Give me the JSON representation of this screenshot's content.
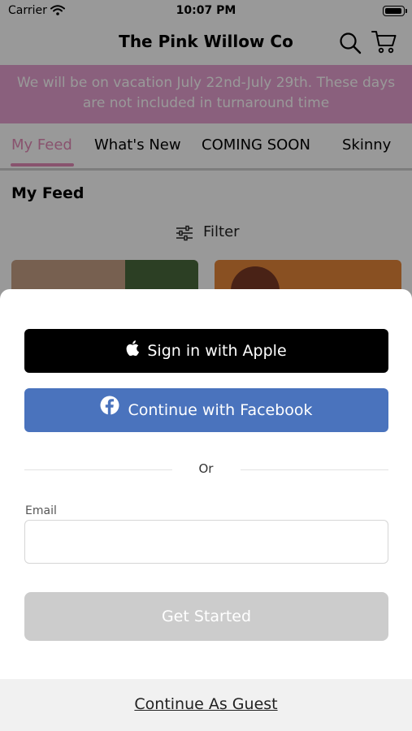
{
  "status_bar": {
    "carrier": "Carrier",
    "time": "10:07 PM"
  },
  "nav": {
    "title": "The Pink Willow Co",
    "search_icon": "search-icon",
    "cart_icon": "cart-icon"
  },
  "banner": {
    "text": "We will be on vacation July 22nd-July 29th. These days are not included in turnaround time",
    "color": "#e6a1d0"
  },
  "tabs": [
    {
      "label": "My Feed",
      "active": true
    },
    {
      "label": "What's New",
      "active": false
    },
    {
      "label": "COMING SOON",
      "active": false
    },
    {
      "label": "Skinny",
      "active": false
    }
  ],
  "feed": {
    "title": "My Feed",
    "filter_label": "Filter"
  },
  "sheet": {
    "apple_button": "Sign in with Apple",
    "facebook_button": "Continue with Facebook",
    "or_text": "Or",
    "email_label": "Email",
    "email_value": "",
    "email_placeholder": "",
    "start_button": "Get Started",
    "guest_link": "Continue As Guest"
  },
  "colors": {
    "accent": "#e58ab8",
    "facebook": "#4a73bd",
    "apple": "#000000",
    "disabled": "#cccccc"
  }
}
